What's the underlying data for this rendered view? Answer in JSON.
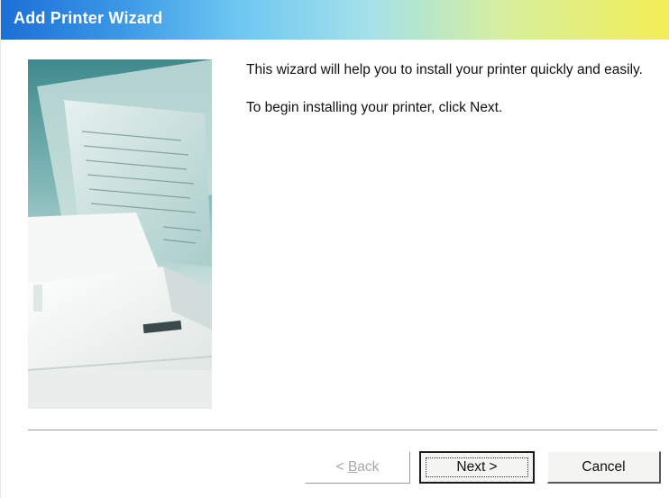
{
  "window": {
    "title": "Add Printer Wizard"
  },
  "intro": {
    "line1": "This wizard will help you to install your printer quickly and easily.",
    "line2": "To begin installing your printer, click Next."
  },
  "buttons": {
    "back_prefix": "< ",
    "back_mnemonic": "B",
    "back_suffix": "ack",
    "next_label": "Next >",
    "cancel_label": "Cancel"
  },
  "colors": {
    "title_gradient_start": "#1c6fd6",
    "title_gradient_end": "#f3ee56",
    "disabled_text": "#a8a8a8"
  },
  "icons": {
    "side_image": "printer-with-document-illustration"
  }
}
